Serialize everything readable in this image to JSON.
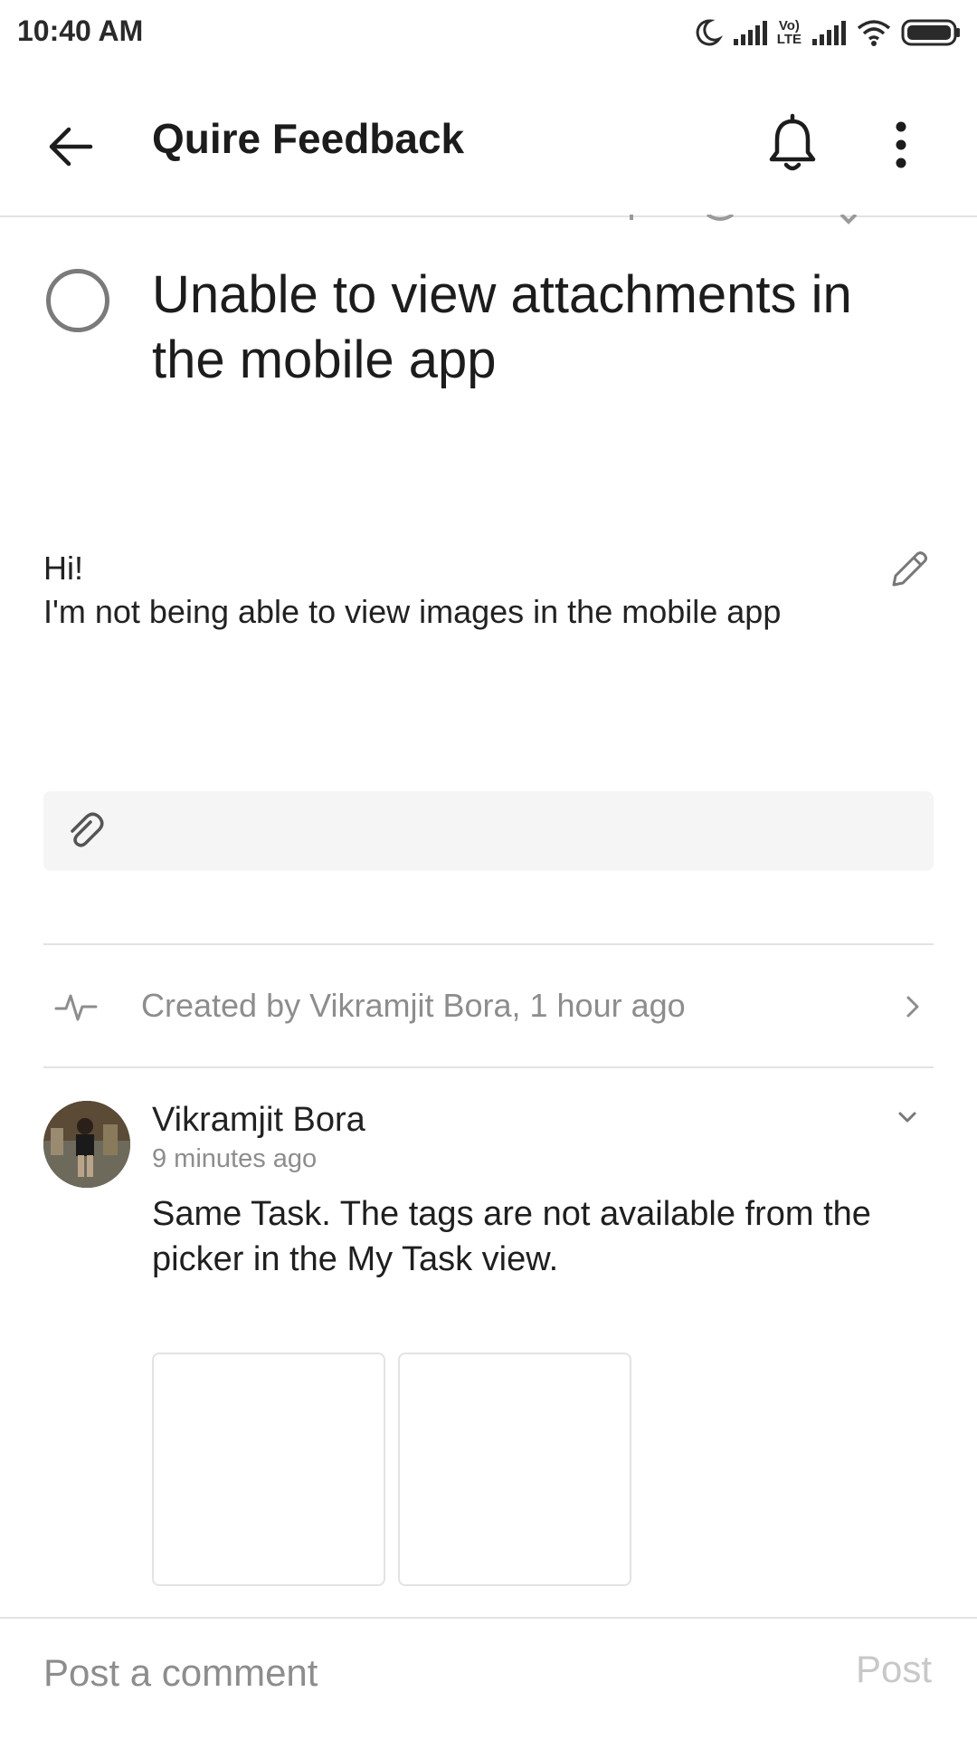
{
  "status_bar": {
    "time": "10:40 AM",
    "icons": [
      "moon-icon",
      "signal-icon",
      "volte-icon",
      "signal-icon",
      "wifi-icon",
      "battery-icon"
    ],
    "volte_text": [
      "Vo)",
      "LTE"
    ]
  },
  "app_bar": {
    "title": "Quire Feedback",
    "back_icon": "arrow-left-icon",
    "notification_icon": "bell-icon",
    "menu_icon": "more-vertical-icon"
  },
  "task": {
    "title": "Unable to view attachments in the mobile app",
    "completed": false,
    "description": "Hi!\nI'm not being able to view images in the mobile app"
  },
  "activity": {
    "text": "Created by Vikramjit Bora, 1 hour ago"
  },
  "comment": {
    "author": "Vikramjit Bora",
    "time": "9 minutes ago",
    "text": "Same Task. The tags are not available from the picker in the My Task view.",
    "attachment_count": 2
  },
  "comment_input": {
    "placeholder": "Post a comment",
    "post_label": "Post"
  },
  "colors": {
    "text_primary": "#1c1c1c",
    "text_secondary": "#8d8d8d",
    "divider": "#e3e3e3",
    "attachment_bg": "#f5f5f5",
    "post_disabled": "#c8c8c8"
  }
}
